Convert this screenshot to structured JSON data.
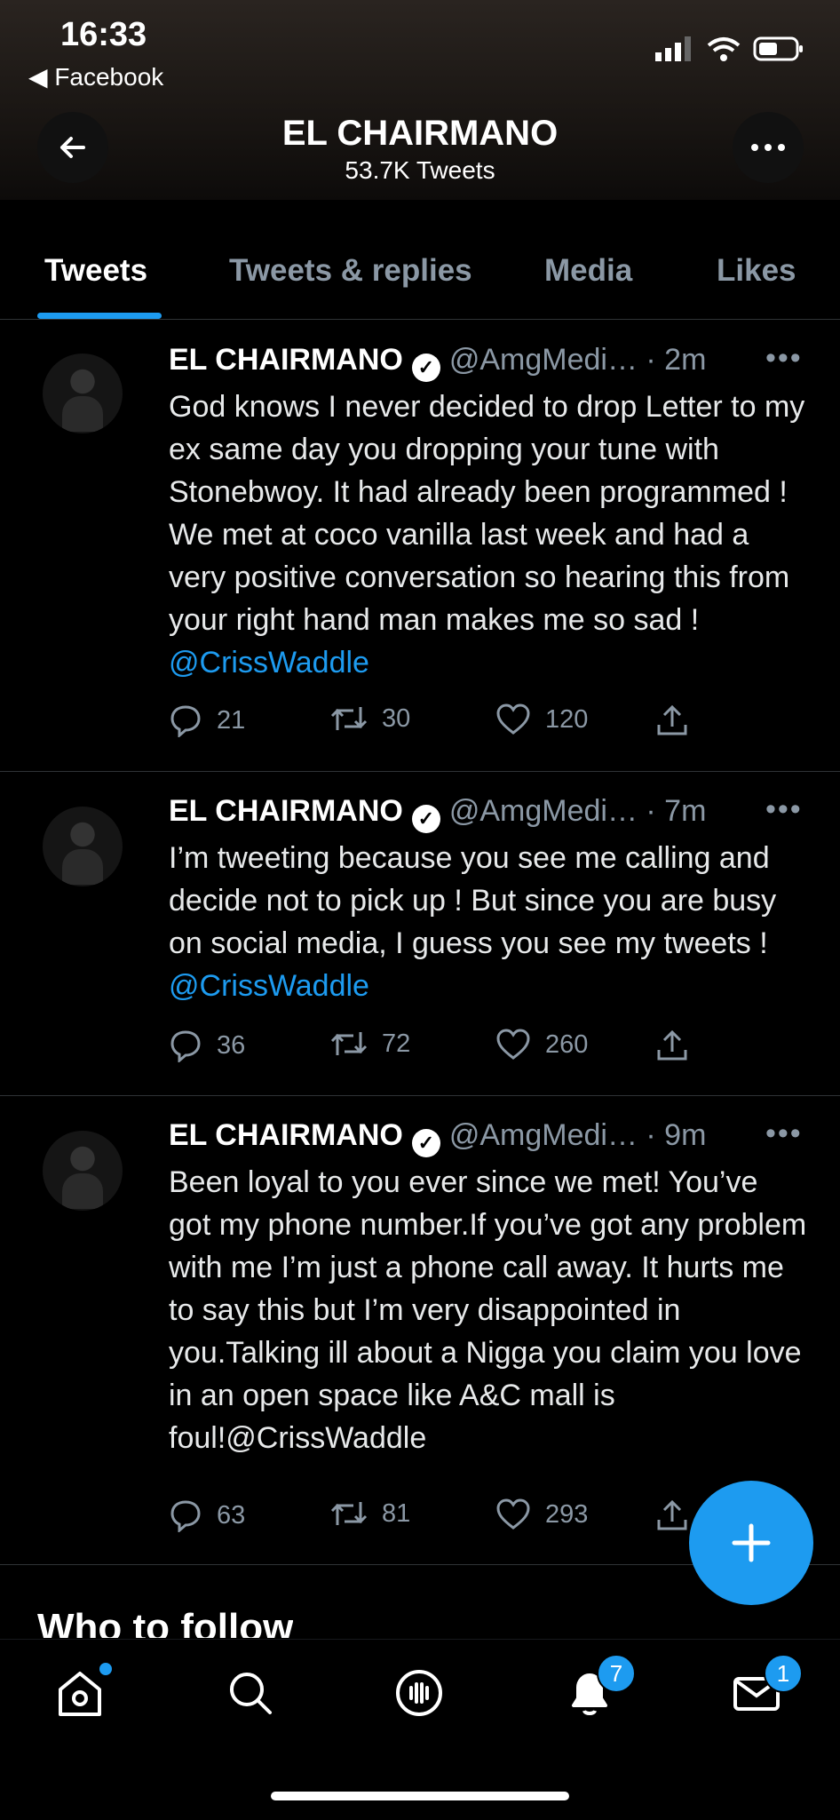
{
  "status": {
    "time": "16:33",
    "back_app": "◀ Facebook"
  },
  "header": {
    "title": "EL CHAIRMANO",
    "subtitle": "53.7K Tweets"
  },
  "tabs": [
    {
      "label": "Tweets"
    },
    {
      "label": "Tweets & replies"
    },
    {
      "label": "Media"
    },
    {
      "label": "Likes"
    }
  ],
  "tweets": [
    {
      "name": "EL CHAIRMANO",
      "handle": "@AmgMedi…",
      "time": "· 2m",
      "text": "God knows I never decided to drop Letter to my ex same day you dropping your tune with Stonebwoy. It had already been programmed ! We met at coco vanilla last week and had a very positive conversation so hearing this from your right hand man makes me so sad ! ",
      "mention": "@CrissWaddle",
      "replies": "21",
      "retweets": "30",
      "likes": "120"
    },
    {
      "name": "EL CHAIRMANO",
      "handle": "@AmgMedi…",
      "time": "· 7m",
      "text": "I’m tweeting because you see me calling and decide not to pick up ! But since you are busy on social media, I guess you see my tweets ! ",
      "mention": "@CrissWaddle",
      "replies": "36",
      "retweets": "72",
      "likes": "260"
    },
    {
      "name": "EL CHAIRMANO",
      "handle": "@AmgMedi…",
      "time": "· 9m",
      "text": "Been loyal to you ever since we met! You’ve got my phone number.If you’ve got any problem with me I’m just a phone call away. It hurts me to say this but I’m very disappointed in you.Talking ill about a Nigga you claim you love in an open space like A&C mall is foul!@CrissWaddle",
      "mention": "",
      "replies": "63",
      "retweets": "81",
      "likes": "293"
    }
  ],
  "who_to_follow": "Who to follow",
  "nav": {
    "notifications_badge": "7",
    "messages_badge": "1"
  },
  "colors": {
    "accent": "#1d9bf0",
    "background": "#000000",
    "muted": "#8b98a5"
  }
}
